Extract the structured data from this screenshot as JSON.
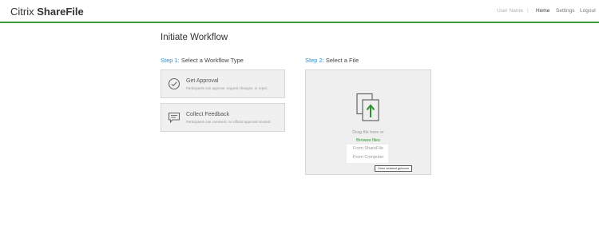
{
  "header": {
    "logo_prefix": "Citrix",
    "logo_suffix": "ShareFile",
    "user_name": "User Name",
    "separator": "|",
    "nav": {
      "home": "Home",
      "settings": "Settings",
      "logout": "Logout"
    },
    "accent_color": "#3c9a3c"
  },
  "main": {
    "title": "Initiate Workflow",
    "step1": {
      "number": "Step 1:",
      "label": "Select a Workflow Type",
      "options": [
        {
          "title": "Get Approval",
          "description": "Participants can approve, request changes, or reject.",
          "icon": "approval-check-icon"
        },
        {
          "title": "Collect Feedback",
          "description": "Participants can comment; no official approval needed.",
          "icon": "comment-icon"
        }
      ]
    },
    "step2": {
      "number": "Step 2:",
      "label": "Select a File",
      "icon": "upload-files-icon",
      "drag_text": "Drag file here or",
      "browse_label": "Browse files",
      "menu": [
        "From ShareFile",
        "From Computer"
      ],
      "tooltip": "Geen bestand gekozen"
    },
    "step_number_color": "#2f8fcf"
  }
}
